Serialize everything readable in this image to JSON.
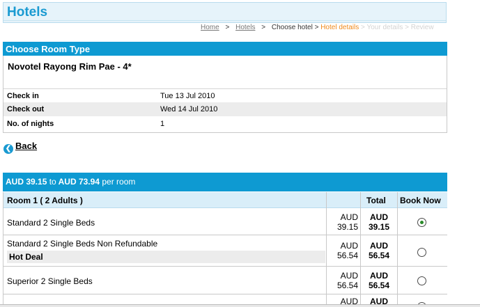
{
  "header": {
    "title": "Hotels"
  },
  "breadcrumb": {
    "items": [
      {
        "label": "Home",
        "state": "link"
      },
      {
        "label": "Hotels",
        "state": "link"
      },
      {
        "label": "Choose hotel",
        "state": "current"
      },
      {
        "label": "Hotel details",
        "state": "active"
      },
      {
        "label": "Your details",
        "state": "future"
      },
      {
        "label": "Review",
        "state": "future"
      }
    ],
    "separator": ">"
  },
  "choose_room": {
    "heading": "Choose Room Type",
    "hotel_name": "Novotel Rayong Rim Pae - 4*",
    "check_in_label": "Check in",
    "check_in_value": "Tue 13 Jul 2010",
    "check_out_label": "Check out",
    "check_out_value": "Wed 14 Jul 2010",
    "nights_label": "No. of nights",
    "nights_value": "1"
  },
  "back": {
    "label": "Back",
    "icon": "back-arrow-icon"
  },
  "price_range": {
    "from": "AUD 39.15",
    "to_word": "to",
    "to": "AUD 73.94",
    "suffix": "per room"
  },
  "rooms_table": {
    "room_header": "Room 1 ( 2 Adults )",
    "total_header": "Total",
    "book_header": "Book Now",
    "rows": [
      {
        "name": "Standard 2 Single Beds",
        "deal": "",
        "currency": "AUD",
        "price": "39.15",
        "total_currency": "AUD",
        "total": "39.15",
        "selected": true
      },
      {
        "name": "Standard 2 Single Beds Non Refundable",
        "deal": "Hot Deal",
        "currency": "AUD",
        "price": "56.54",
        "total_currency": "AUD",
        "total": "56.54",
        "selected": false
      },
      {
        "name": "Superior 2 Single Beds",
        "deal": "",
        "currency": "AUD",
        "price": "56.54",
        "total_currency": "AUD",
        "total": "56.54",
        "selected": false
      },
      {
        "name": "",
        "deal": "",
        "currency": "AUD",
        "price": "",
        "total_currency": "AUD",
        "total": "",
        "selected": false
      }
    ]
  },
  "colors": {
    "accent_blue": "#0e9ad2",
    "title_blue": "#1a9ad1",
    "breadcrumb_active": "#f08a1c"
  }
}
